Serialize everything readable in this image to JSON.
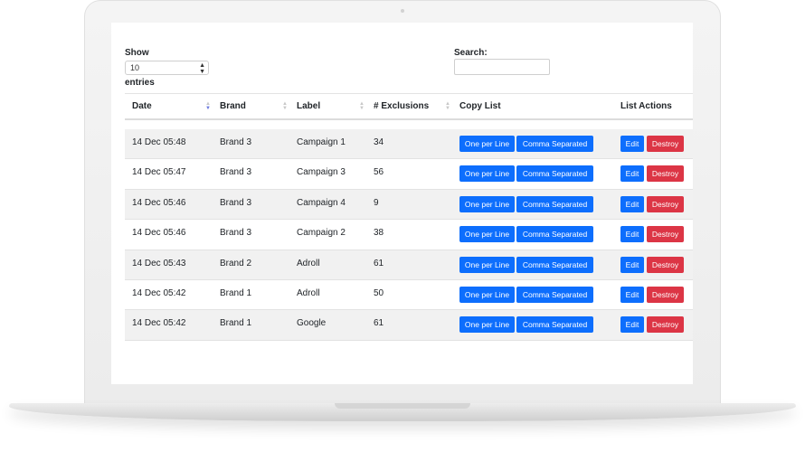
{
  "controls": {
    "show_label": "Show",
    "entries_value": "10",
    "entries_label": "entries",
    "search_label": "Search:",
    "search_value": ""
  },
  "table": {
    "columns": [
      "Date",
      "Brand",
      "Label",
      "# Exclusions",
      "Copy List",
      "List Actions"
    ],
    "sorted_column": "Date",
    "sort_direction": "descending",
    "rows": [
      {
        "date": "14 Dec 05:48",
        "brand": "Brand 3",
        "label": "Campaign 1",
        "exclusions": "34"
      },
      {
        "date": "14 Dec 05:47",
        "brand": "Brand 3",
        "label": "Campaign 3",
        "exclusions": "56"
      },
      {
        "date": "14 Dec 05:46",
        "brand": "Brand 3",
        "label": "Campaign 4",
        "exclusions": "9"
      },
      {
        "date": "14 Dec 05:46",
        "brand": "Brand 3",
        "label": "Campaign 2",
        "exclusions": "38"
      },
      {
        "date": "14 Dec 05:43",
        "brand": "Brand 2",
        "label": "Adroll",
        "exclusions": "61"
      },
      {
        "date": "14 Dec 05:42",
        "brand": "Brand 1",
        "label": "Adroll",
        "exclusions": "50"
      },
      {
        "date": "14 Dec 05:42",
        "brand": "Brand 1",
        "label": "Google",
        "exclusions": "61"
      }
    ]
  },
  "buttons": {
    "one_per_line": "One per Line",
    "comma_separated": "Comma Separated",
    "edit": "Edit",
    "destroy": "Destroy"
  },
  "colors": {
    "primary": "#0d6efd",
    "danger": "#dc3545",
    "striped_row": "#f1f1f1",
    "sort_active": "#6c7ae0"
  },
  "icons": {
    "select_arrows": "up-down-chevron-icon",
    "sort_indicator": "sort-arrows-icon"
  }
}
